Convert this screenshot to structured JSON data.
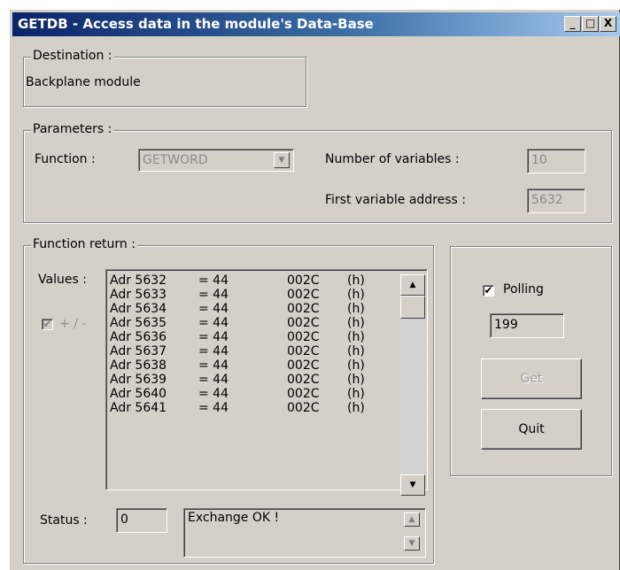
{
  "window": {
    "title": "GETDB - Access data in the module's Data-Base",
    "controls": [
      "_",
      "□",
      "X"
    ]
  },
  "destination": {
    "legend": "Destination :",
    "value": "Backplane module"
  },
  "parameters": {
    "legend": "Parameters :",
    "function_label": "Function :",
    "function_value": "GETWORD",
    "num_vars_label": "Number of variables :",
    "num_vars_value": "10",
    "first_addr_label": "First variable address :",
    "first_addr_value": "5632"
  },
  "function_return": {
    "legend": "Function return :",
    "values_label": "Values :",
    "plus_minus_label": "+ / -",
    "plus_minus_checked": true,
    "rows": [
      {
        "adr": "Adr 5632",
        "val": "= 44",
        "hex": "002C",
        "unit": "(h)"
      },
      {
        "adr": "Adr 5633",
        "val": "= 44",
        "hex": "002C",
        "unit": "(h)"
      },
      {
        "adr": "Adr 5634",
        "val": "= 44",
        "hex": "002C",
        "unit": "(h)"
      },
      {
        "adr": "Adr 5635",
        "val": "= 44",
        "hex": "002C",
        "unit": "(h)"
      },
      {
        "adr": "Adr 5636",
        "val": "= 44",
        "hex": "002C",
        "unit": "(h)"
      },
      {
        "adr": "Adr 5637",
        "val": "= 44",
        "hex": "002C",
        "unit": "(h)"
      },
      {
        "adr": "Adr 5638",
        "val": "= 44",
        "hex": "002C",
        "unit": "(h)"
      },
      {
        "adr": "Adr 5639",
        "val": "= 44",
        "hex": "002C",
        "unit": "(h)"
      },
      {
        "adr": "Adr 5640",
        "val": "= 44",
        "hex": "002C",
        "unit": "(h)"
      },
      {
        "adr": "Adr 5641",
        "val": "= 44",
        "hex": "002C",
        "unit": "(h)"
      }
    ],
    "status_label": "Status :",
    "status_code": "0",
    "status_message": "Exchange OK !"
  },
  "polling": {
    "label": "Polling",
    "checked": true,
    "value": "199",
    "get_label": "Get",
    "quit_label": "Quit"
  }
}
